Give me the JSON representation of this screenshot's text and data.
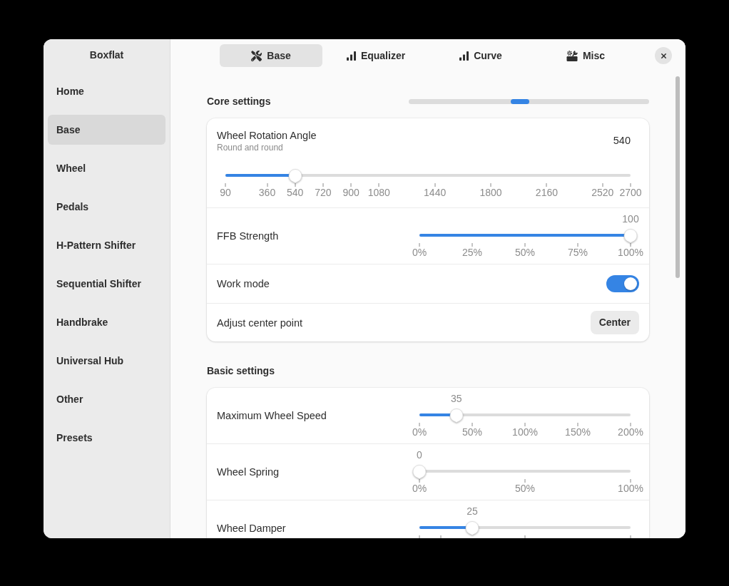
{
  "window": {
    "title": "Boxflat"
  },
  "sidebar": {
    "items": [
      {
        "label": "Home",
        "selected": false
      },
      {
        "label": "Base",
        "selected": true
      },
      {
        "label": "Wheel",
        "selected": false
      },
      {
        "label": "Pedals",
        "selected": false
      },
      {
        "label": "H-Pattern Shifter",
        "selected": false
      },
      {
        "label": "Sequential Shifter",
        "selected": false
      },
      {
        "label": "Handbrake",
        "selected": false
      },
      {
        "label": "Universal Hub",
        "selected": false
      },
      {
        "label": "Other",
        "selected": false
      },
      {
        "label": "Presets",
        "selected": false
      }
    ]
  },
  "tabs": [
    {
      "label": "Base",
      "selected": true
    },
    {
      "label": "Equalizer",
      "selected": false
    },
    {
      "label": "Curve",
      "selected": false
    },
    {
      "label": "Misc",
      "selected": false
    }
  ],
  "sections": [
    {
      "title": "Core settings",
      "position_meter": {
        "level": 0.463
      },
      "rows": [
        {
          "kind": "wide_slider",
          "label": "Wheel Rotation Angle",
          "subtitle": "Round and round",
          "reading": "540",
          "level": 0.172,
          "marks": [
            {
              "label": "90",
              "level": 0
            },
            {
              "label": "360",
              "level": 0.103
            },
            {
              "label": "540",
              "level": 0.172
            },
            {
              "label": "720",
              "level": 0.241
            },
            {
              "label": "900",
              "level": 0.31
            },
            {
              "label": "1080",
              "level": 0.379
            },
            {
              "label": "1440",
              "level": 0.517
            },
            {
              "label": "1800",
              "level": 0.655
            },
            {
              "label": "2160",
              "level": 0.793
            },
            {
              "label": "2520",
              "level": 0.931
            },
            {
              "label": "2700",
              "level": 1
            }
          ]
        },
        {
          "kind": "slider",
          "label": "FFB Strength",
          "reading": "100",
          "level": 1,
          "marks": [
            {
              "label": "0%",
              "level": 0
            },
            {
              "label": "25%",
              "level": 0.25
            },
            {
              "label": "50%",
              "level": 0.5
            },
            {
              "label": "75%",
              "level": 0.75
            },
            {
              "label": "100%",
              "level": 1
            }
          ]
        },
        {
          "kind": "switch",
          "label": "Work mode",
          "on": true
        },
        {
          "kind": "button",
          "label": "Adjust center point",
          "button": "Center"
        }
      ]
    },
    {
      "title": "Basic settings",
      "rows": [
        {
          "kind": "slider",
          "label": "Maximum Wheel Speed",
          "reading": "35",
          "level": 0.175,
          "marks": [
            {
              "label": "0%",
              "level": 0
            },
            {
              "label": "50%",
              "level": 0.25
            },
            {
              "label": "100%",
              "level": 0.5
            },
            {
              "label": "150%",
              "level": 0.75
            },
            {
              "label": "200%",
              "level": 1
            }
          ]
        },
        {
          "kind": "slider",
          "label": "Wheel Spring",
          "reading": "0",
          "level": 0,
          "marks": [
            {
              "label": "0%",
              "level": 0
            },
            {
              "label": "50%",
              "level": 0.5
            },
            {
              "label": "100%",
              "level": 1
            }
          ]
        },
        {
          "kind": "slider",
          "label": "Wheel Damper",
          "reading": "25",
          "level": 0.25,
          "marks": [
            {
              "level": 0
            },
            {
              "level": 0.1
            },
            {
              "level": 0.5
            },
            {
              "level": 1
            }
          ]
        }
      ]
    }
  ]
}
